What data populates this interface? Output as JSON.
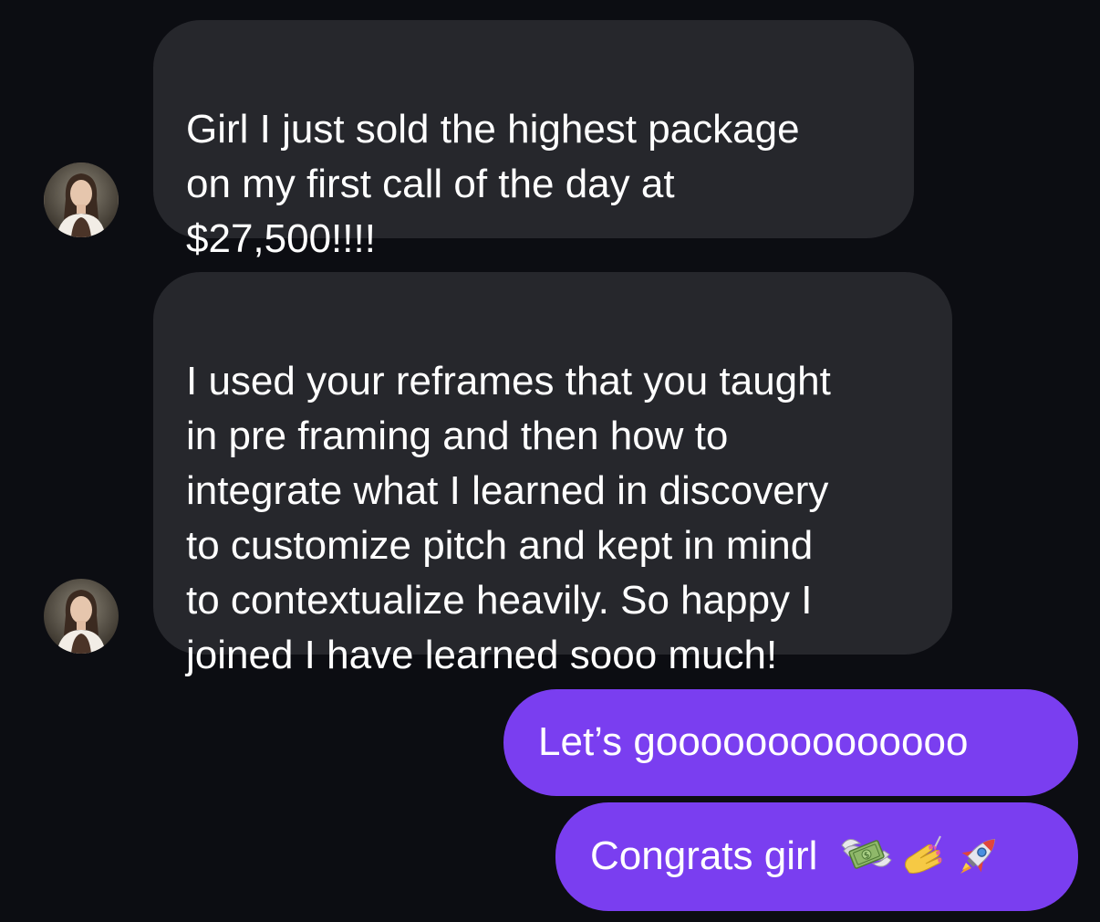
{
  "messages": [
    {
      "sender": "contact",
      "text": "Girl I just sold the highest package\non my first call of the day at\n$27,500!!!!"
    },
    {
      "sender": "contact",
      "text": "I used your reframes that you taught\nin pre framing and then how to\nintegrate what I learned in discovery\nto customize pitch and kept in mind\nto contextualize  heavily. So happy I\njoined I have learned sooo much!"
    },
    {
      "sender": "me",
      "text": "Let’s goooooooooooooo"
    },
    {
      "sender": "me",
      "text": "Congrats girl",
      "emojis": [
        "money-with-wings-icon",
        "nail-polish-icon",
        "rocket-icon"
      ]
    }
  ],
  "colors": {
    "background": "#0c0d12",
    "incoming_bubble": "#26272c",
    "outgoing_bubble": "#7a3ef0",
    "text": "#ffffff"
  }
}
